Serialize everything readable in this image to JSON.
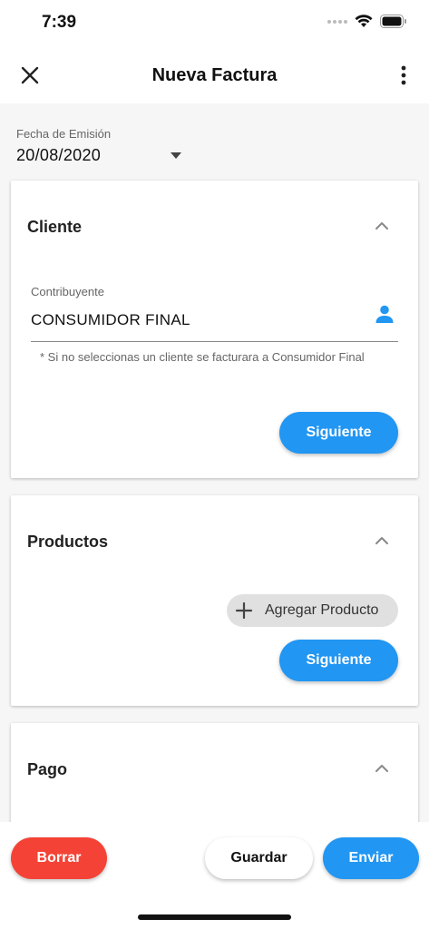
{
  "status_bar": {
    "time": "7:39",
    "icons": [
      "signal-dots-icon",
      "wifi-icon",
      "battery-icon"
    ]
  },
  "app_bar": {
    "title": "Nueva Factura",
    "leading_icon": "close-icon",
    "trailing_icon": "more-vert-icon"
  },
  "date": {
    "label": "Fecha de Emisión",
    "value": "20/08/2020"
  },
  "cliente_card": {
    "title": "Cliente",
    "field_label": "Contribuyente",
    "field_value": "CONSUMIDOR FINAL",
    "helper_text": "* Si no seleccionas un cliente se facturara a Consumidor Final",
    "next_label": "Siguiente"
  },
  "productos_card": {
    "title": "Productos",
    "add_label": "Agregar Producto",
    "next_label": "Siguiente"
  },
  "pago_card": {
    "title": "Pago"
  },
  "bottom_bar": {
    "delete_label": "Borrar",
    "save_label": "Guardar",
    "send_label": "Enviar"
  },
  "colors": {
    "primary": "#2196f3",
    "danger": "#f44336",
    "background": "#f6f6f6"
  }
}
